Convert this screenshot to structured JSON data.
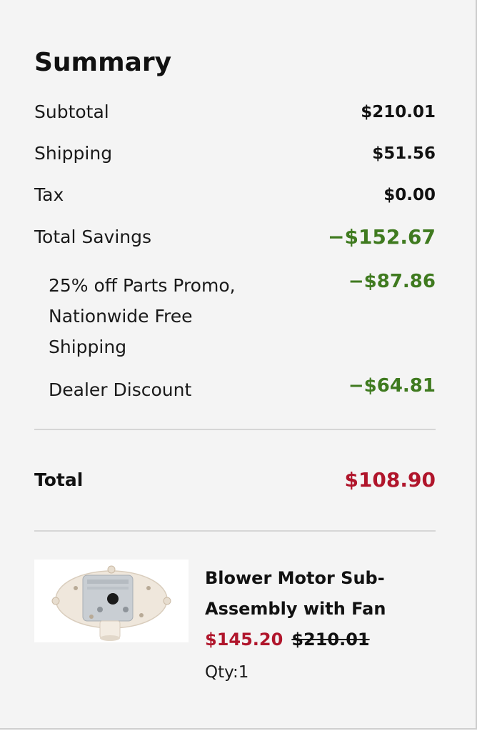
{
  "summary": {
    "title": "Summary",
    "subtotal": {
      "label": "Subtotal",
      "value": "$210.01"
    },
    "shipping": {
      "label": "Shipping",
      "value": "$51.56"
    },
    "tax": {
      "label": "Tax",
      "value": "$0.00"
    },
    "total_savings": {
      "label": "Total Savings",
      "value": "−$152.67"
    },
    "savings_items": [
      {
        "label": "25% off Parts Promo, Nationwide Free Shipping",
        "value": "−$87.86"
      },
      {
        "label": "Dealer Discount",
        "value": "−$64.81"
      }
    ],
    "total": {
      "label": "Total",
      "value": "$108.90"
    }
  },
  "product": {
    "image_icon": "blower-motor-image",
    "name": "Blower Motor Sub-Assembly with Fan",
    "sale_price": "$145.20",
    "original_price": "$210.01",
    "qty": "Qty:1"
  },
  "colors": {
    "savings_green": "#3f7a1f",
    "total_red": "#b0152b",
    "panel_bg": "#f4f4f4"
  }
}
